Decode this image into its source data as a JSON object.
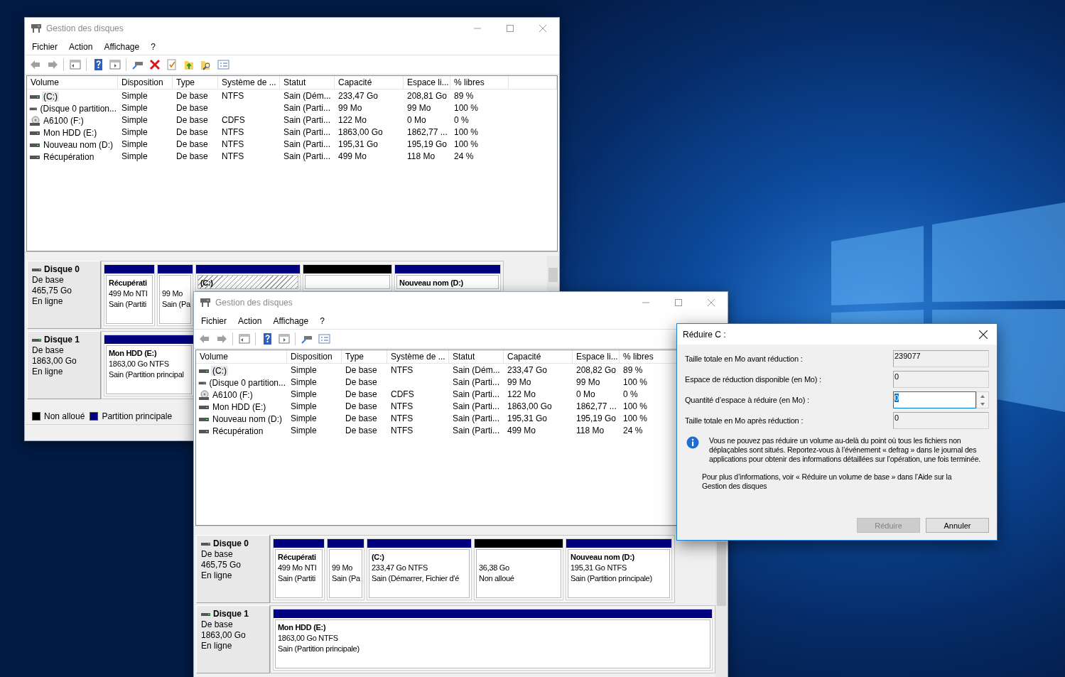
{
  "windows": [
    {
      "title": "Gestion des disques",
      "menu": [
        "Fichier",
        "Action",
        "Affichage",
        "?"
      ],
      "toolbar": [
        {
          "kind": "back"
        },
        {
          "kind": "forward"
        },
        {
          "kind": "separator"
        },
        {
          "kind": "console"
        },
        {
          "kind": "separator"
        },
        {
          "kind": "help"
        },
        {
          "kind": "panel"
        },
        {
          "kind": "separator"
        },
        {
          "kind": "connect"
        },
        {
          "kind": "delete"
        },
        {
          "kind": "check"
        },
        {
          "kind": "folderup"
        },
        {
          "kind": "foldersearch"
        },
        {
          "kind": "list"
        }
      ],
      "columns": [
        "Volume",
        "Disposition",
        "Type",
        "Système de ...",
        "Statut",
        "Capacité",
        "Espace li...",
        "% libres"
      ],
      "rows": [
        {
          "kind": "disk",
          "selected": true,
          "cells": [
            "(C:)",
            "Simple",
            "De base",
            "NTFS",
            "Sain (Dém...",
            "233,47 Go",
            "208,81 Go",
            "89 %"
          ]
        },
        {
          "kind": "disk",
          "selected": false,
          "cells": [
            "(Disque 0 partition...",
            "Simple",
            "De base",
            "",
            "Sain (Parti...",
            "99 Mo",
            "99 Mo",
            "100 %"
          ]
        },
        {
          "kind": "cd",
          "selected": false,
          "cells": [
            "A6100 (F:)",
            "Simple",
            "De base",
            "CDFS",
            "Sain (Parti...",
            "122 Mo",
            "0 Mo",
            "0 %"
          ]
        },
        {
          "kind": "disk",
          "selected": false,
          "cells": [
            "Mon HDD (E:)",
            "Simple",
            "De base",
            "NTFS",
            "Sain (Parti...",
            "1863,00 Go",
            "1862,77 ...",
            "100 %"
          ]
        },
        {
          "kind": "disk",
          "selected": false,
          "cells": [
            "Nouveau nom (D:)",
            "Simple",
            "De base",
            "NTFS",
            "Sain (Parti...",
            "195,31 Go",
            "195,19 Go",
            "100 %"
          ]
        },
        {
          "kind": "disk",
          "selected": false,
          "cells": [
            "Récupération",
            "Simple",
            "De base",
            "NTFS",
            "Sain (Parti...",
            "499 Mo",
            "118 Mo",
            "24 %"
          ]
        }
      ],
      "disks": [
        {
          "name": "Disque 0",
          "lines": [
            "De base",
            "465,75 Go",
            "En ligne"
          ],
          "partitions": [
            {
              "kind": "primary",
              "selected": false,
              "name": "Récupérati",
              "lines": [
                "499 Mo NTI",
                "Sain (Partiti"
              ]
            },
            {
              "kind": "primary",
              "selected": false,
              "lines": [
                "99 Mo",
                "Sain (Pa"
              ]
            },
            {
              "kind": "primary",
              "selected": true,
              "name": "(C:)"
            },
            {
              "kind": "unallocated",
              "selected": false
            },
            {
              "kind": "primary",
              "selected": false,
              "name": "Nouveau nom  (D:)"
            }
          ]
        },
        {
          "name": "Disque 1",
          "lines": [
            "De base",
            "1863,00 Go",
            "En ligne"
          ],
          "partitions": [
            {
              "kind": "primary",
              "selected": false,
              "name": "Mon HDD  (E:)",
              "lines": [
                "1863,00 Go NTFS",
                "Sain (Partition principal"
              ]
            }
          ]
        }
      ],
      "legend": [
        {
          "label": "Non alloué",
          "color": "#000000"
        },
        {
          "label": "Partition principale",
          "color": "#000080"
        }
      ]
    },
    {
      "title": "Gestion des disques",
      "menu": [
        "Fichier",
        "Action",
        "Affichage",
        "?"
      ],
      "toolbar": [
        {
          "kind": "back"
        },
        {
          "kind": "forward"
        },
        {
          "kind": "separator"
        },
        {
          "kind": "console"
        },
        {
          "kind": "separator"
        },
        {
          "kind": "help"
        },
        {
          "kind": "panel"
        },
        {
          "kind": "separator"
        },
        {
          "kind": "connect"
        },
        {
          "kind": "list"
        }
      ],
      "columns": [
        "Volume",
        "Disposition",
        "Type",
        "Système de ...",
        "Statut",
        "Capacité",
        "Espace li...",
        "% libres"
      ],
      "rows": [
        {
          "kind": "disk",
          "selected": true,
          "cells": [
            "(C:)",
            "Simple",
            "De base",
            "NTFS",
            "Sain (Dém...",
            "233,47 Go",
            "208,82 Go",
            "89 %"
          ]
        },
        {
          "kind": "disk",
          "selected": false,
          "cells": [
            "(Disque 0 partition...",
            "Simple",
            "De base",
            "",
            "Sain (Parti...",
            "99 Mo",
            "99 Mo",
            "100 %"
          ]
        },
        {
          "kind": "cd",
          "selected": false,
          "cells": [
            "A6100 (F:)",
            "Simple",
            "De base",
            "CDFS",
            "Sain (Parti...",
            "122 Mo",
            "0 Mo",
            "0 %"
          ]
        },
        {
          "kind": "disk",
          "selected": false,
          "cells": [
            "Mon HDD (E:)",
            "Simple",
            "De base",
            "NTFS",
            "Sain (Parti...",
            "1863,00 Go",
            "1862,77 ...",
            "100 %"
          ]
        },
        {
          "kind": "disk",
          "selected": false,
          "cells": [
            "Nouveau nom (D:)",
            "Simple",
            "De base",
            "NTFS",
            "Sain (Parti...",
            "195,31 Go",
            "195,19 Go",
            "100 %"
          ]
        },
        {
          "kind": "disk",
          "selected": false,
          "cells": [
            "Récupération",
            "Simple",
            "De base",
            "NTFS",
            "Sain (Parti...",
            "499 Mo",
            "118 Mo",
            "24 %"
          ]
        }
      ],
      "disks": [
        {
          "name": "Disque 0",
          "lines": [
            "De base",
            "465,75 Go",
            "En ligne"
          ],
          "partitions": [
            {
              "kind": "primary",
              "selected": false,
              "name": "Récupérati",
              "lines": [
                "499 Mo NTI",
                "Sain (Partiti"
              ]
            },
            {
              "kind": "primary",
              "selected": false,
              "lines": [
                "99 Mo",
                "Sain (Pa"
              ]
            },
            {
              "kind": "primary",
              "selected": false,
              "name": "(C:)",
              "lines": [
                "233,47 Go NTFS",
                "Sain (Démarrer, Fichier d'é"
              ]
            },
            {
              "kind": "unallocated",
              "selected": false,
              "lines": [
                "36,38 Go",
                "Non alloué"
              ]
            },
            {
              "kind": "primary",
              "selected": false,
              "name": "Nouveau nom  (D:)",
              "lines": [
                "195,31 Go NTFS",
                "Sain (Partition principale)"
              ]
            }
          ]
        },
        {
          "name": "Disque 1",
          "lines": [
            "De base",
            "1863,00 Go",
            "En ligne"
          ],
          "partitions": [
            {
              "kind": "primary",
              "selected": false,
              "name": "Mon HDD  (E:)",
              "lines": [
                "1863,00 Go NTFS",
                "Sain (Partition principale)"
              ]
            }
          ]
        }
      ]
    }
  ],
  "dialog": {
    "title": "Réduire C :",
    "fields": [
      {
        "kind": "readonly",
        "label": "Taille totale en Mo avant réduction :",
        "value": "239077"
      },
      {
        "kind": "readonly",
        "label": "Espace de réduction disponible (en Mo) :",
        "value": "0"
      },
      {
        "kind": "spinner",
        "label": "Quantité d’espace à réduire (en Mo) :",
        "value": "0"
      },
      {
        "kind": "readonly",
        "label": "Taille totale en Mo après réduction :",
        "value": "0"
      }
    ],
    "info": "Vous ne pouvez pas réduire un volume au-delà du point où tous les fichiers non déplaçables sont situés. Reportez-vous à l’événement « defrag » dans le journal des applications pour obtenir des informations détaillées sur l’opération, une fois terminée.",
    "help": "Pour plus d’informations, voir « Réduire un volume de base » dans l’Aide sur la Gestion des disques",
    "buttons": [
      {
        "label": "Réduire",
        "disabled": true
      },
      {
        "label": "Annuler",
        "disabled": false
      }
    ]
  }
}
